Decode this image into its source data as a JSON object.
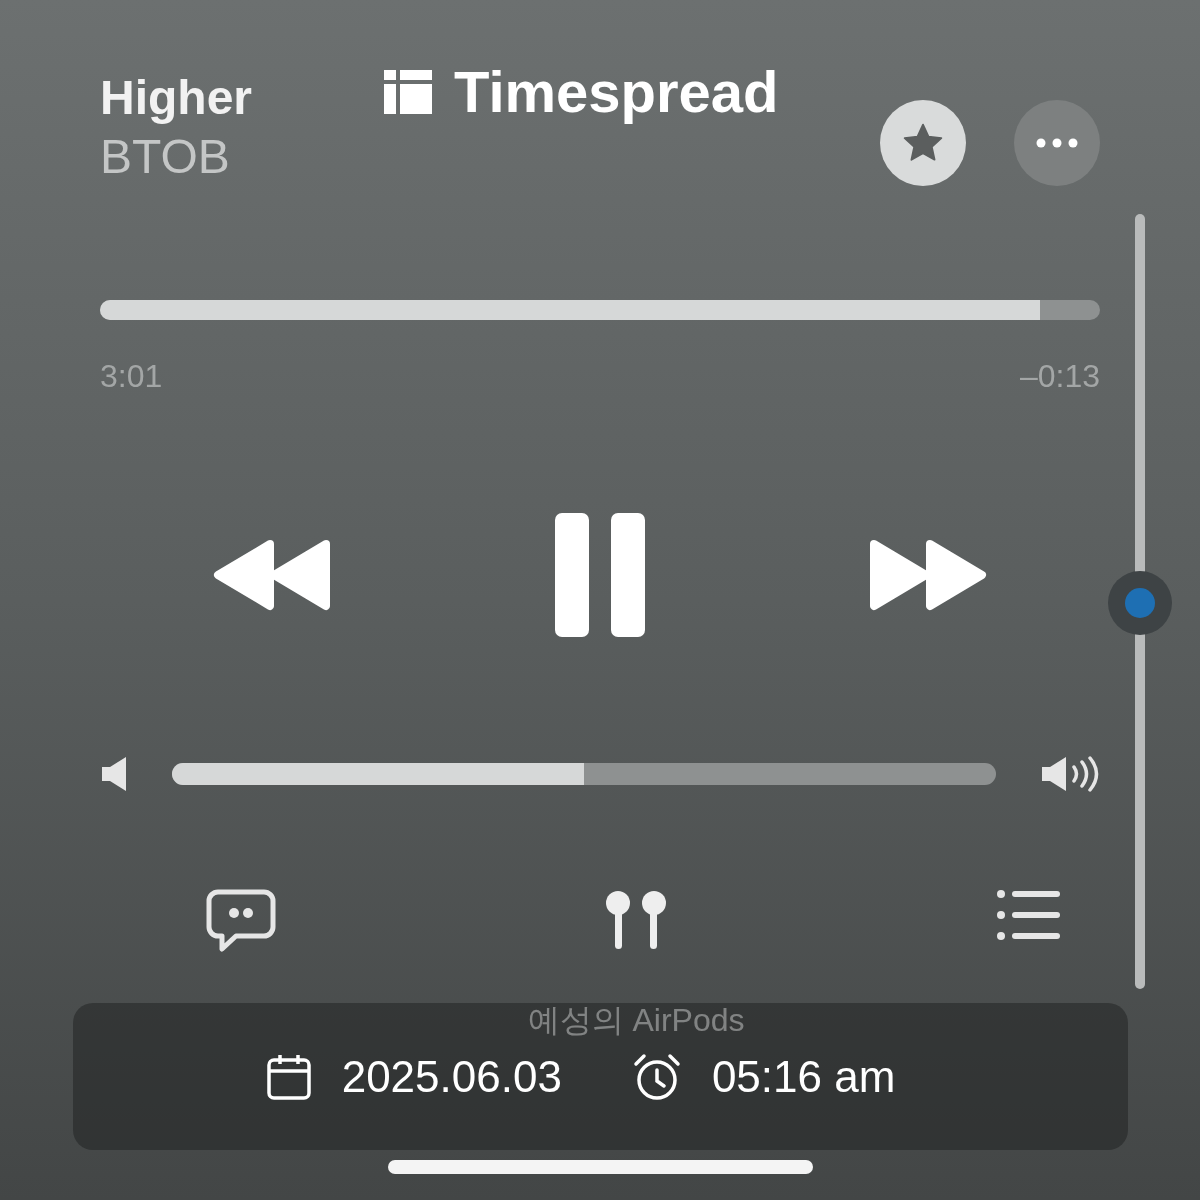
{
  "track": {
    "title": "Higher",
    "artist": "BTOB"
  },
  "progress": {
    "level": 0.94,
    "elapsed": "3:01",
    "remaining": "–0:13"
  },
  "playback": {
    "playing": true
  },
  "volume": {
    "level": 0.5
  },
  "output": {
    "device": "예성의 AirPods"
  },
  "stamp": {
    "brand": "Timespread",
    "date": "2025.06.03",
    "time": "05:16 am"
  }
}
